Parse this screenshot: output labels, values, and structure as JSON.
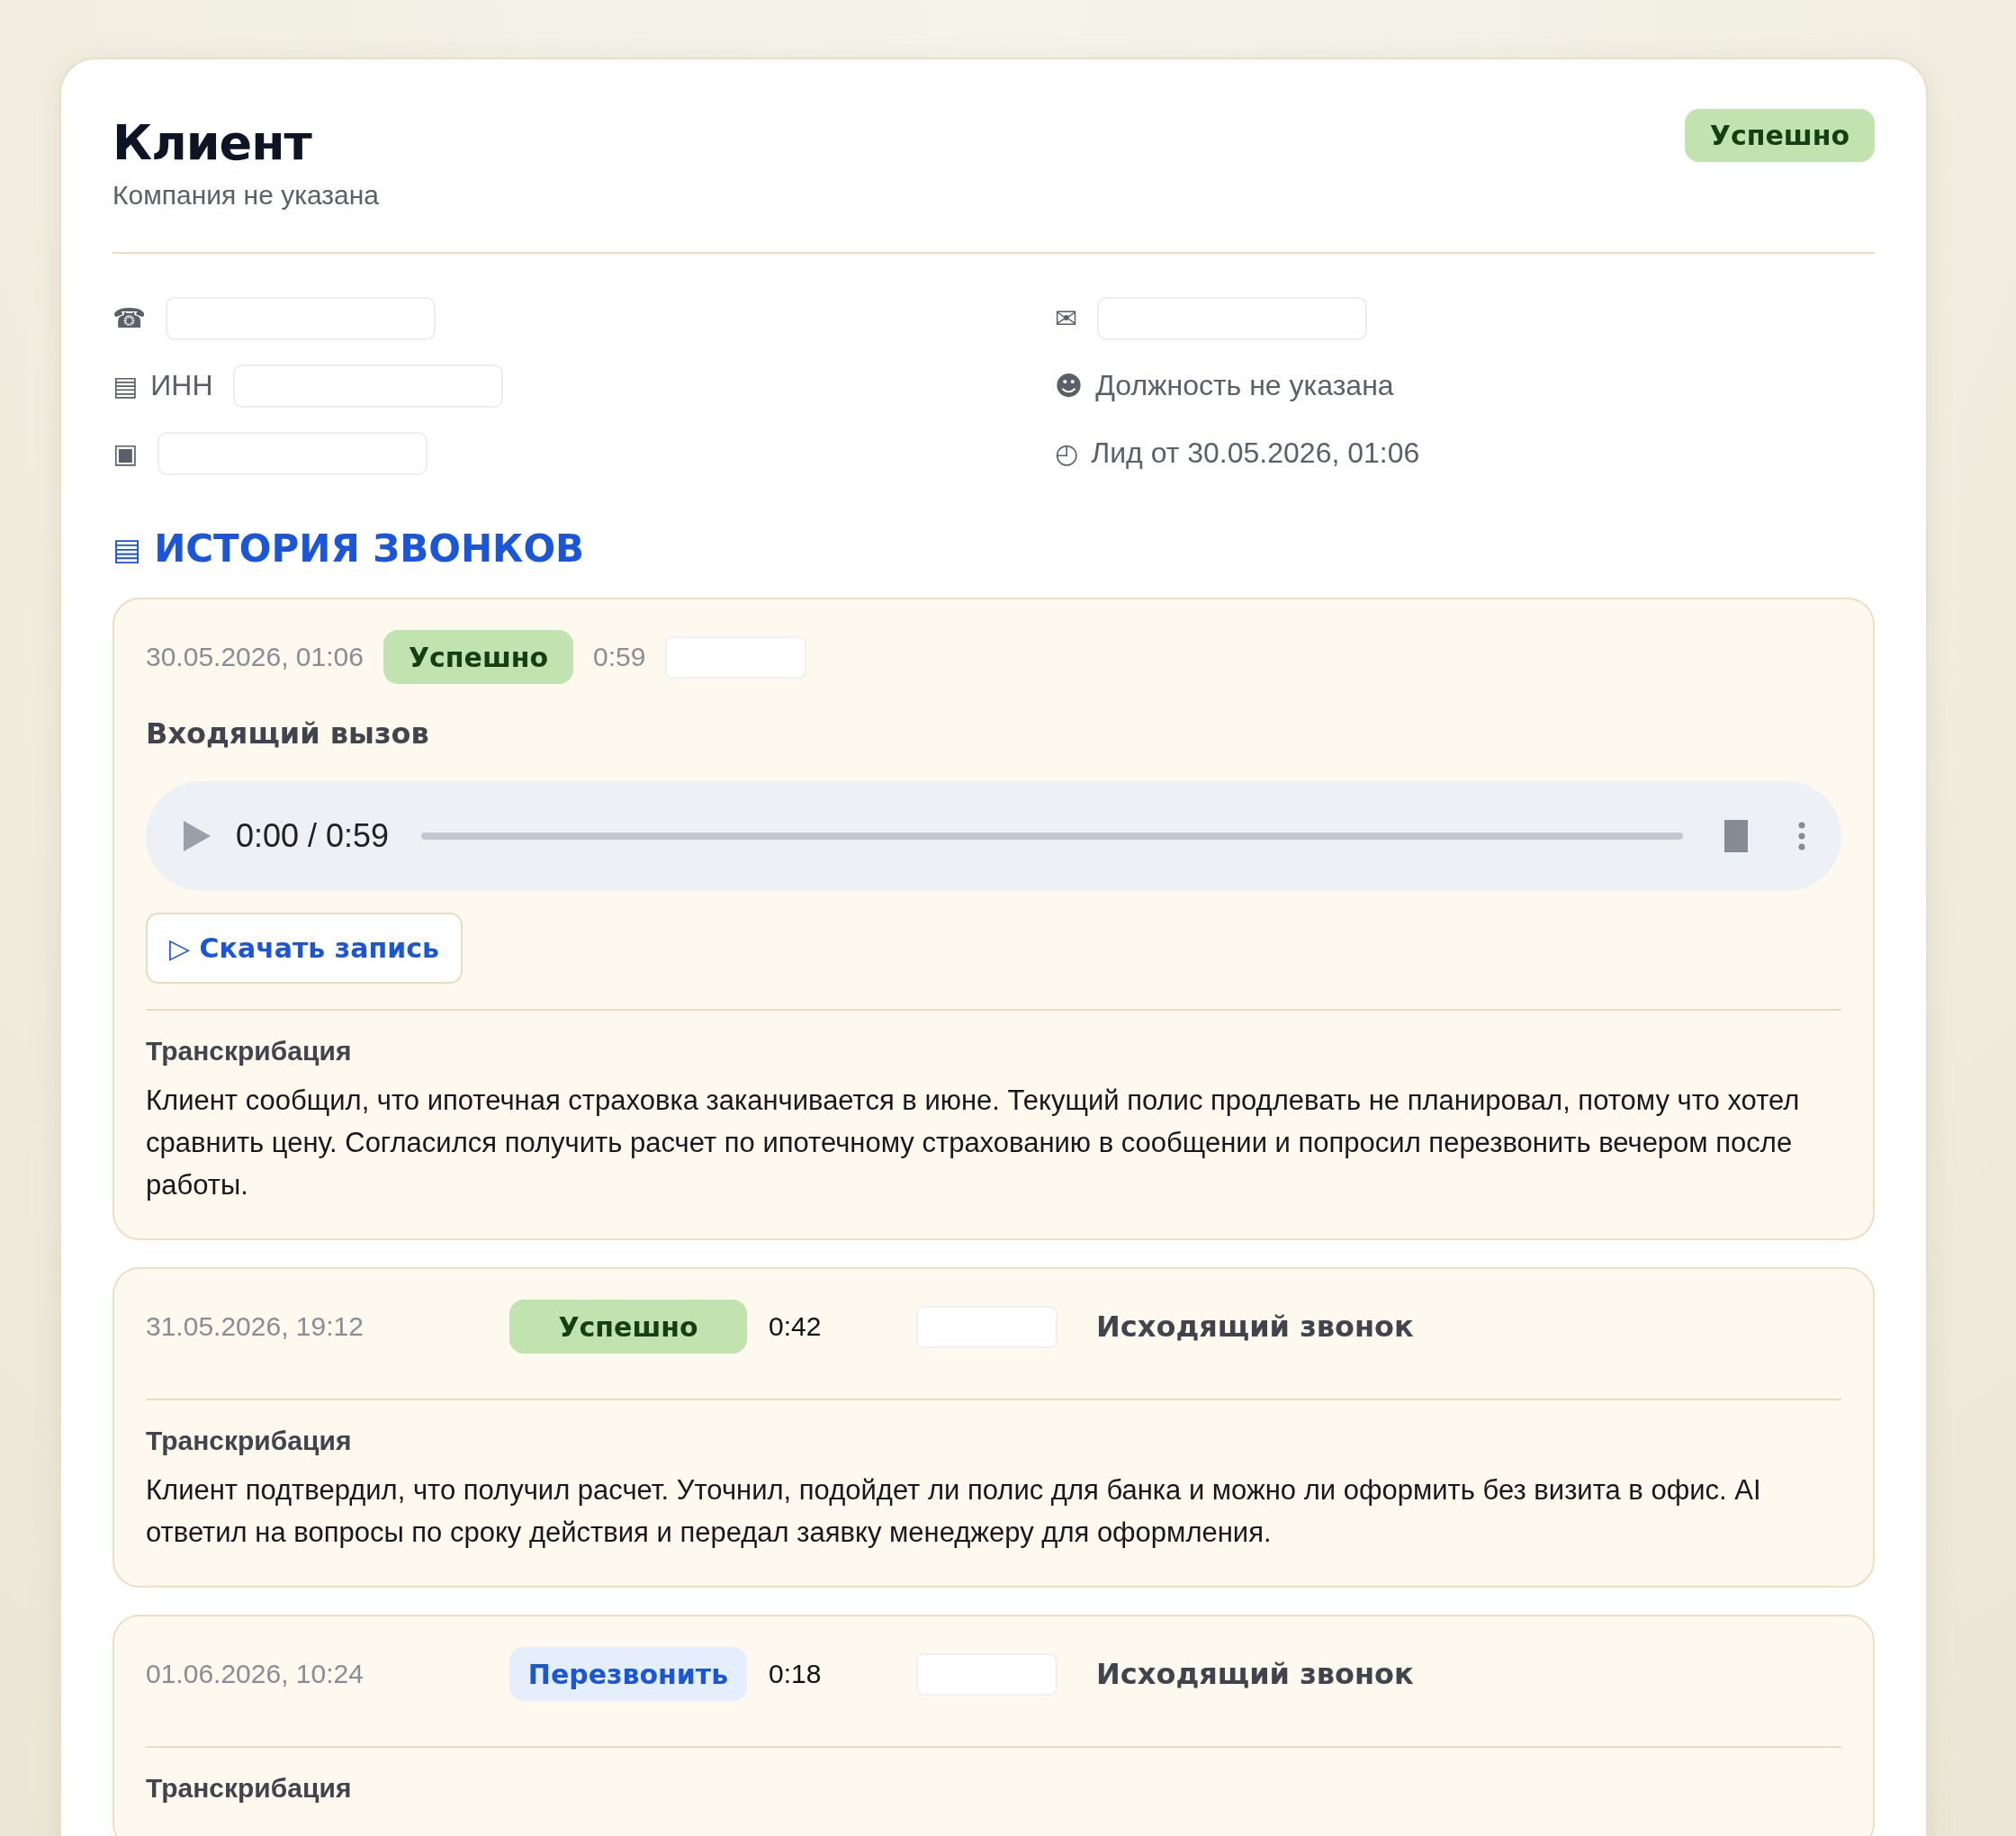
{
  "client": {
    "name": "Клиент",
    "company": "Компания не указана",
    "status": {
      "label": "Успешно",
      "kind": "success"
    }
  },
  "contacts": {
    "left": [
      {
        "icon": "☎",
        "kind": "field"
      },
      {
        "icon": "▤",
        "kind": "field",
        "label": "ИНН"
      },
      {
        "icon": "▣",
        "kind": "field"
      }
    ],
    "right": [
      {
        "icon": "✉",
        "kind": "field"
      },
      {
        "icon": "☻",
        "kind": "text",
        "text": "Должность не указана"
      },
      {
        "icon": "◴",
        "kind": "text",
        "text": "Лид от 30.05.2026, 01:06"
      }
    ]
  },
  "history": {
    "icon": "▤",
    "title": "ИСТОРИЯ ЗВОНКОВ",
    "calls": [
      {
        "kind": "recording",
        "datetime": "30.05.2026, 01:06",
        "status": {
          "label": "Успешно",
          "kind": "success"
        },
        "duration": "0:59",
        "title": "Входящий вызов",
        "player": {
          "time": "0:00 / 0:59",
          "level": 0
        },
        "download": "▷ Скачать запись",
        "transcript_title": "Транскрибация",
        "transcript": "Клиент сообщил, что ипотечная страховка заканчивается в июне. Текущий полис продлевать не планировал, потому что хотел сравнить цену. Согласился получить расчет по ипотечному страхованию в сообщении и попросил перезвонить вечером после работы."
      },
      {
        "kind": "compact",
        "datetime": "31.05.2026, 19:12",
        "status": {
          "label": "Успешно",
          "kind": "success"
        },
        "duration": "0:42",
        "title": "Исходящий звонок",
        "transcript_title": "Транскрибация",
        "transcript": "Клиент подтвердил, что получил расчет. Уточнил, подойдет ли полис для банка и можно ли оформить без визита в офис. AI ответил на вопросы по сроку действия и передал заявку менеджеру для оформления."
      },
      {
        "kind": "compact",
        "datetime": "01.06.2026, 10:24",
        "status": {
          "label": "Перезвонить",
          "kind": "callback"
        },
        "duration": "0:18",
        "title": "Исходящий звонок",
        "transcript_title": "Транскрибация"
      }
    ]
  }
}
